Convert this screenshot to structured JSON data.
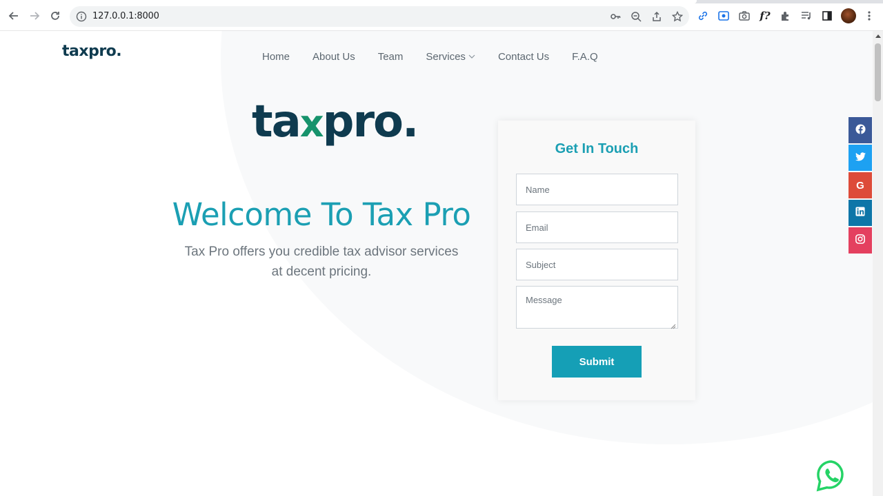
{
  "browser": {
    "url": "127.0.0.1:8000"
  },
  "site": {
    "logo_text_left": "ta",
    "logo_text_x": "x",
    "logo_text_right": "pro",
    "logo_dot": "."
  },
  "nav": {
    "items": [
      {
        "label": "Home"
      },
      {
        "label": "About Us"
      },
      {
        "label": "Team"
      },
      {
        "label": "Services"
      },
      {
        "label": "Contact Us"
      },
      {
        "label": "F.A.Q"
      }
    ]
  },
  "hero": {
    "title": "Welcome To Tax Pro",
    "subtitle": "Tax Pro offers you credible tax advisor services at decent pricing."
  },
  "contact_form": {
    "title": "Get In Touch",
    "name_placeholder": "Name",
    "email_placeholder": "Email",
    "subject_placeholder": "Subject",
    "message_placeholder": "Message",
    "submit_label": "Submit"
  },
  "social": {
    "facebook_color": "#3b5998",
    "twitter_color": "#1da1f2",
    "google_color": "#dd4b39",
    "linkedin_color": "#0e76a8",
    "instagram_color": "#e4405f",
    "google_glyph": "G"
  },
  "colors": {
    "accent": "#1b9fb3",
    "brand_dark": "#0f3b4f",
    "brand_green": "#17936c",
    "whatsapp": "#25d366"
  }
}
